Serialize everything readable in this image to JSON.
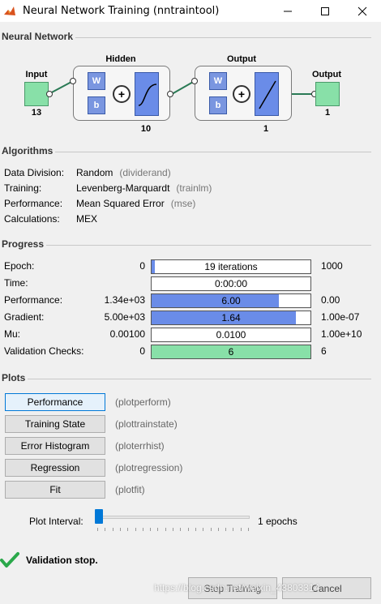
{
  "window": {
    "title": "Neural Network Training (nntraintool)",
    "minimize_icon": "minimize-icon",
    "maximize_icon": "maximize-icon",
    "close_icon": "close-icon",
    "app_icon": "matlab-icon"
  },
  "network": {
    "section_title": "Neural Network",
    "input_label": "Input",
    "input_size": "13",
    "hidden_label": "Hidden",
    "hidden_size": "10",
    "output_layer_label": "Output",
    "output_layer_size": "1",
    "output_label": "Output",
    "output_size": "1",
    "w": "W",
    "b": "b",
    "plus": "+"
  },
  "algorithms": {
    "section_title": "Algorithms",
    "rows": [
      {
        "label": "Data Division:",
        "value": "Random",
        "hint": "(dividerand)"
      },
      {
        "label": "Training:",
        "value": "Levenberg-Marquardt",
        "hint": "(trainlm)"
      },
      {
        "label": "Performance:",
        "value": "Mean Squared Error",
        "hint": "(mse)"
      },
      {
        "label": "Calculations:",
        "value": "MEX",
        "hint": ""
      }
    ]
  },
  "progress": {
    "section_title": "Progress",
    "rows": [
      {
        "label": "Epoch:",
        "min": "0",
        "value": "19 iterations",
        "max": "1000",
        "fill": 0.019,
        "color": "#6a8ce8"
      },
      {
        "label": "Time:",
        "min": "",
        "value": "0:00:00",
        "max": "",
        "fill": 0,
        "color": "#6a8ce8"
      },
      {
        "label": "Performance:",
        "min": "1.34e+03",
        "value": "6.00",
        "max": "0.00",
        "fill": 0.8,
        "color": "#6a8ce8"
      },
      {
        "label": "Gradient:",
        "min": "5.00e+03",
        "value": "1.64",
        "max": "1.00e-07",
        "fill": 0.91,
        "color": "#6a8ce8"
      },
      {
        "label": "Mu:",
        "min": "0.00100",
        "value": "0.0100",
        "max": "1.00e+10",
        "fill": 0,
        "color": "#6a8ce8"
      },
      {
        "label": "Validation Checks:",
        "min": "0",
        "value": "6",
        "max": "6",
        "fill": 1.0,
        "color": "#88e0a8"
      }
    ]
  },
  "plots": {
    "section_title": "Plots",
    "buttons": [
      {
        "label": "Performance",
        "hint": "(plotperform)"
      },
      {
        "label": "Training State",
        "hint": "(plottrainstate)"
      },
      {
        "label": "Error Histogram",
        "hint": "(ploterrhist)"
      },
      {
        "label": "Regression",
        "hint": "(plotregression)"
      },
      {
        "label": "Fit",
        "hint": "(plotfit)"
      }
    ],
    "interval_label": "Plot Interval:",
    "interval_value": "1 epochs",
    "interval_level": 0.0
  },
  "status": {
    "icon": "checkmark-icon",
    "text": "Validation stop."
  },
  "bottom": {
    "stop_label": "Stop Training",
    "cancel_label": "Cancel",
    "watermark": "https://blog.csdn.net/weixin_43803314"
  }
}
